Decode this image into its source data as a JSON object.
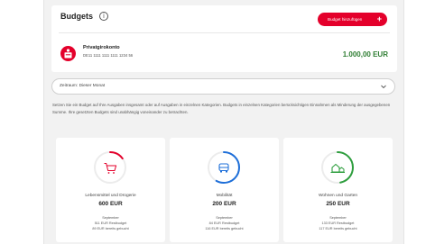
{
  "header": {
    "title": "Budgets",
    "info_icon": "info-icon",
    "add_button_label": "Budget hinzufügen",
    "add_icon": "+"
  },
  "account": {
    "logo_icon": "sparkasse-logo-icon",
    "name": "Privatgirokonto",
    "iban": "DE11 1111 1111 1111 1234 56",
    "balance": "1.000,00 EUR"
  },
  "filter": {
    "period_label": "Zeitraum: Dieser Monat"
  },
  "description": "Setzen Sie ein Budget auf Ihre Ausgaben insgesamt oder auf Ausgaben in einzelnen Kategorien. Budgets in einzelnen Kategorien berücksichtigen Einnahmen als Minderung der ausgegebenen Summe. Ihre gesetzten Budgets sind unabhängig voneinander zu betrachten.",
  "budgets": [
    {
      "category": "Lebensmittel und Drogerie",
      "amount": "600 EUR",
      "month": "September",
      "remaining": "511 EUR Restbudget",
      "spent": "89 EUR bereits gebucht",
      "spent_fraction": 0.15,
      "color": "#e4002b",
      "icon": "cart-icon"
    },
    {
      "category": "Mobilität",
      "amount": "200 EUR",
      "month": "September",
      "remaining": "84 EUR Restbudget",
      "spent": "116 EUR bereits gebucht",
      "spent_fraction": 0.58,
      "color": "#1e6fd9",
      "icon": "car-icon"
    },
    {
      "category": "Wohnen und Garten",
      "amount": "250 EUR",
      "month": "September",
      "remaining": "133 EUR Restbudget",
      "spent": "117 EUR bereits gebucht",
      "spent_fraction": 0.47,
      "color": "#2e9e3e",
      "icon": "house-icon"
    }
  ]
}
